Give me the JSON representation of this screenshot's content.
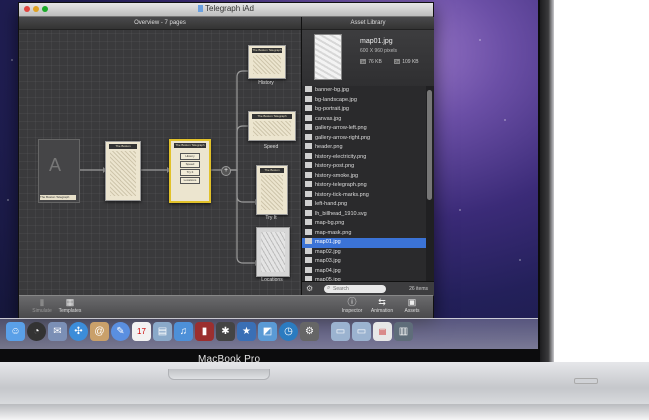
{
  "window": {
    "title": "Telegraph iAd",
    "overview_title": "Overview - 7 pages",
    "asset_library_title": "Asset Library"
  },
  "pages": {
    "placeholder_label": "The Boston Telegraph",
    "page_header": "The Boston Telegraph",
    "menu_buttons": [
      "History",
      "Speed",
      "Try It",
      "Locations"
    ],
    "labels": [
      "History",
      "Speed",
      "Try It",
      "Locations"
    ]
  },
  "preview": {
    "name": "map01.jpg",
    "dimensions": "600 X 960 pixels",
    "size_1x_badge": "1x",
    "size_1x": "76 KB",
    "size_2x_badge": "2x",
    "size_2x": "109 KB"
  },
  "assets": [
    "banner-bg.jpg",
    "bg-landscape.jpg",
    "bg-portrait.jpg",
    "canvas.jpg",
    "gallery-arrow-left.png",
    "gallery-arrow-right.png",
    "header.png",
    "history-electricity.png",
    "history-post.png",
    "history-smoke.jpg",
    "history-telegraph.png",
    "history-tick-marks.png",
    "left-hand.png",
    "lh_billhead_1910.svg",
    "map-bg.png",
    "map-mask.png",
    "map01.jpg",
    "map02.jpg",
    "map03.jpg",
    "map04.jpg",
    "map05.jpg"
  ],
  "selected_asset_index": 16,
  "asset_footer": {
    "search_placeholder": "Search",
    "count": "26 items"
  },
  "toolbar": {
    "simulate": "Simulate",
    "templates": "Templates",
    "inspector": "Inspector",
    "animation": "Animation",
    "assets": "Assets"
  },
  "dock": {
    "calendar_day": "17"
  },
  "laptop": {
    "brand": "MacBook Pro"
  },
  "colors": {
    "selection": "#3b73d6",
    "page_highlight": "#e2c22a"
  }
}
